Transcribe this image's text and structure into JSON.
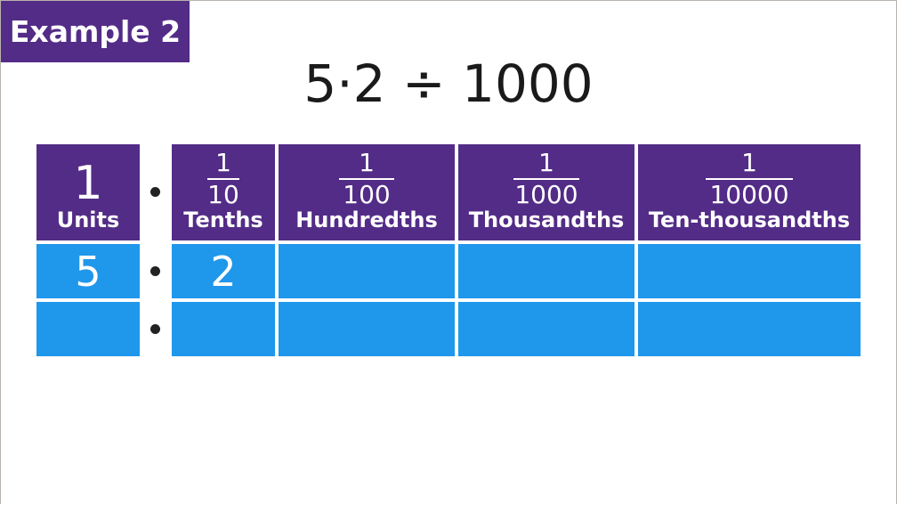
{
  "badge": "Example 2",
  "title": "5·2 ÷ 1000",
  "columns": [
    {
      "value": "1",
      "label": "Units"
    },
    {
      "numerator": "1",
      "denominator": "10",
      "label": "Tenths"
    },
    {
      "numerator": "1",
      "denominator": "100",
      "label": "Hundredths"
    },
    {
      "numerator": "1",
      "denominator": "1000",
      "label": "Thousandths"
    },
    {
      "numerator": "1",
      "denominator": "10000",
      "label": "Ten-thousandths"
    }
  ],
  "rows": [
    [
      "5",
      "2",
      "",
      "",
      ""
    ],
    [
      "",
      "",
      "",
      "",
      ""
    ]
  ],
  "colors": {
    "header": "#532c87",
    "cell": "#1f97eb"
  }
}
